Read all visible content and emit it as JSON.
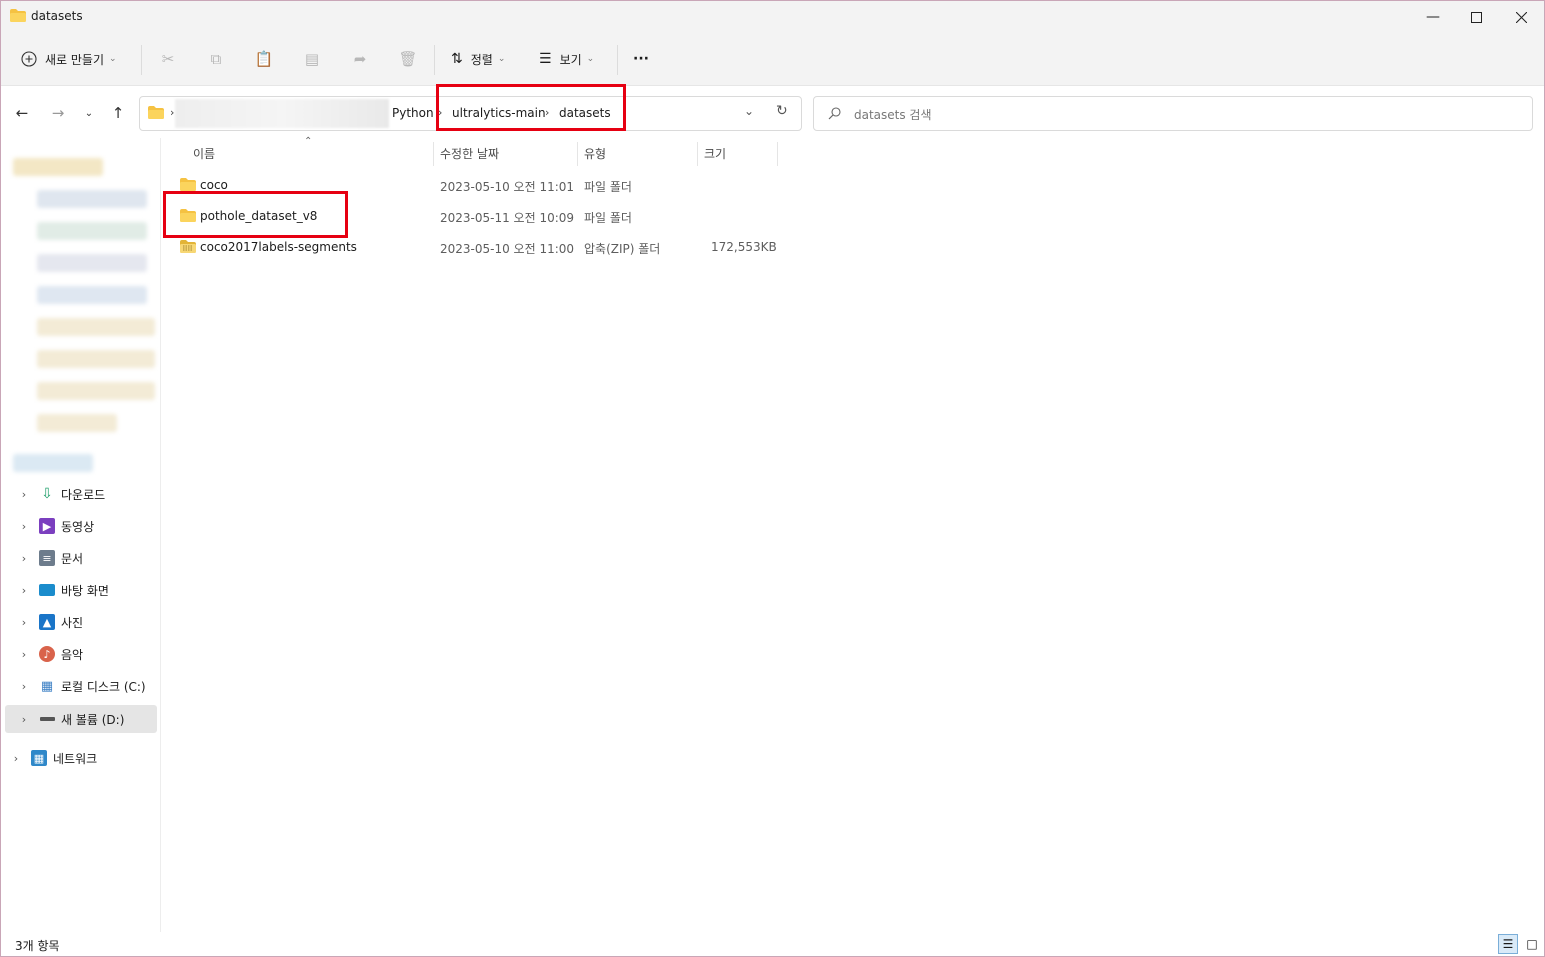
{
  "window": {
    "title": "datasets",
    "controls": [
      "minimize",
      "maximize",
      "close"
    ]
  },
  "toolbar": {
    "new_label": "새로 만들기",
    "sort_label": "정렬",
    "view_label": "보기",
    "more_label": "···"
  },
  "address": {
    "crumbs": [
      "Python",
      "ultralytics-main",
      "datasets"
    ],
    "search_placeholder": "datasets 검색"
  },
  "sidebar": {
    "items": [
      {
        "label": "다운로드",
        "icon": "download-icon",
        "color": "#1e9e6a"
      },
      {
        "label": "동영상",
        "icon": "video-icon",
        "color": "#7b3fbf"
      },
      {
        "label": "문서",
        "icon": "document-icon",
        "color": "#5c6b7a"
      },
      {
        "label": "바탕 화면",
        "icon": "desktop-icon",
        "color": "#1b8ccc"
      },
      {
        "label": "사진",
        "icon": "photo-icon",
        "color": "#1a75c8"
      },
      {
        "label": "음악",
        "icon": "music-icon",
        "color": "#d9634b"
      },
      {
        "label": "로컬 디스크 (C:)",
        "icon": "drive-c-icon",
        "color": "#3b7fc4"
      },
      {
        "label": "새 볼륨 (D:)",
        "icon": "drive-d-icon",
        "color": "#555555"
      }
    ],
    "network_label": "네트워크"
  },
  "columns": {
    "name": "이름",
    "modified": "수정한 날짜",
    "type": "유형",
    "size": "크기"
  },
  "files": [
    {
      "name": "coco",
      "modified": "2023-05-10 오전 11:01",
      "type": "파일 폴더",
      "size": "",
      "kind": "folder"
    },
    {
      "name": "pothole_dataset_v8",
      "modified": "2023-05-11 오전 10:09",
      "type": "파일 폴더",
      "size": "",
      "kind": "folder"
    },
    {
      "name": "coco2017labels-segments",
      "modified": "2023-05-10 오전 11:00",
      "type": "압축(ZIP) 폴더",
      "size": "172,553KB",
      "kind": "zip"
    }
  ],
  "status": {
    "count_text": "3개 항목"
  },
  "colors": {
    "highlight": "#e60012",
    "folder": "#f5c242",
    "accent": "#0067c0"
  }
}
